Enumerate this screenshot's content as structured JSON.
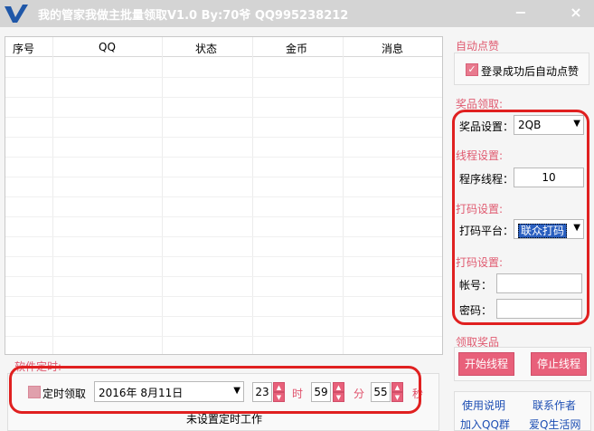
{
  "window": {
    "title": "我的管家我做主批量领取V1.0 By:70爷 QQ995238212",
    "minimize": "−",
    "close": "×"
  },
  "grid": {
    "columns": [
      "序号",
      "QQ",
      "状态",
      "金币",
      "消息"
    ],
    "rows": []
  },
  "auto_like": {
    "section": "自动点赞",
    "checkbox_label": "登录成功后自动点赞",
    "checked": true
  },
  "prize": {
    "section": "奖品领取:",
    "label": "奖品设置：",
    "value": "2QB"
  },
  "thread": {
    "section": "线程设置:",
    "label": "程序线程：",
    "value": "10"
  },
  "captcha": {
    "section": "打码设置:",
    "label": "打码平台：",
    "value": "联众打码"
  },
  "captcha_account": {
    "section": "打码设置:",
    "account_label": "帐号：",
    "account_value": "",
    "password_label": "密码：",
    "password_value": ""
  },
  "claim": {
    "section": "领取奖品",
    "start_label": "开始线程",
    "stop_label": "停止线程"
  },
  "timer": {
    "section": "软件定时:",
    "checkbox_label": "定时领取",
    "date": "2016年  8月11日",
    "hour": "23",
    "hour_unit": "时",
    "minute": "59",
    "minute_unit": "分",
    "second": "55",
    "second_unit": "秒",
    "status": "未设置定时工作"
  },
  "links": {
    "help": "使用说明",
    "contact": "联系作者",
    "join_group": "加入QQ群",
    "site": "爱Q生活网"
  },
  "colors": {
    "accent": "#e8607a",
    "section_text": "#e05a70",
    "highlight": "#e02020",
    "link": "#1e4fb4"
  }
}
